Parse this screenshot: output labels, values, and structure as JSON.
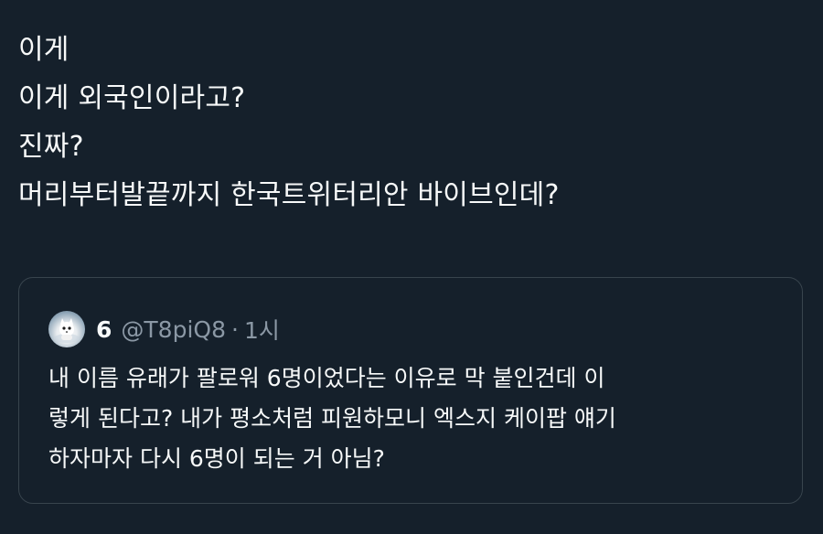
{
  "tweet": {
    "lines": [
      "이게",
      "이게 외국인이라고?",
      "진짜?",
      "머리부터발끝까지 한국트위터리안 바이브인데?"
    ]
  },
  "quote": {
    "author_name": "6",
    "author_handle": "@T8piQ8",
    "separator": "·",
    "time": "1시",
    "avatar_icon": "avatar-cat-icon",
    "lines": [
      "내 이름 유래가 팔로워 6명이었다는 이유로 막 붙인건데 이",
      "렇게 된다고? 내가 평소처럼 피원하모니 엑스지 케이팝 얘기",
      "하자마자 다시 6명이 되는 거 아님?"
    ]
  },
  "colors": {
    "background": "#15202b",
    "text_primary": "#f7f9f9",
    "text_secondary": "#8b98a5",
    "border": "#38444d"
  }
}
